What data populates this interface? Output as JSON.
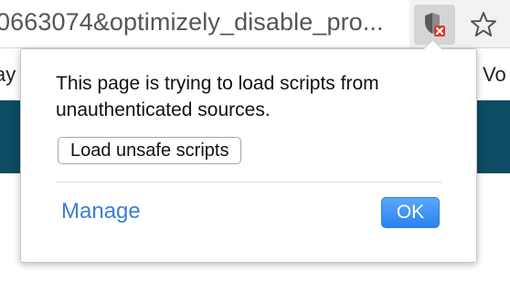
{
  "browser": {
    "url_text": "0663074&optimizely_disable_pro...",
    "icons": {
      "shield": "shield-blocked-icon",
      "star": "bookmark-star-icon"
    },
    "colors": {
      "blocked_badge": "#d93b30"
    }
  },
  "page": {
    "left_fragment": "ay",
    "right_fragment": "Vo",
    "banner_color": "#0d4a63"
  },
  "bubble": {
    "message": "This page is trying to load scripts from unauthenticated sources.",
    "load_button_label": "Load unsafe scripts",
    "manage_label": "Manage",
    "ok_label": "OK",
    "colors": {
      "link": "#3b7fd1",
      "ok_button": "#2a82f3"
    }
  }
}
